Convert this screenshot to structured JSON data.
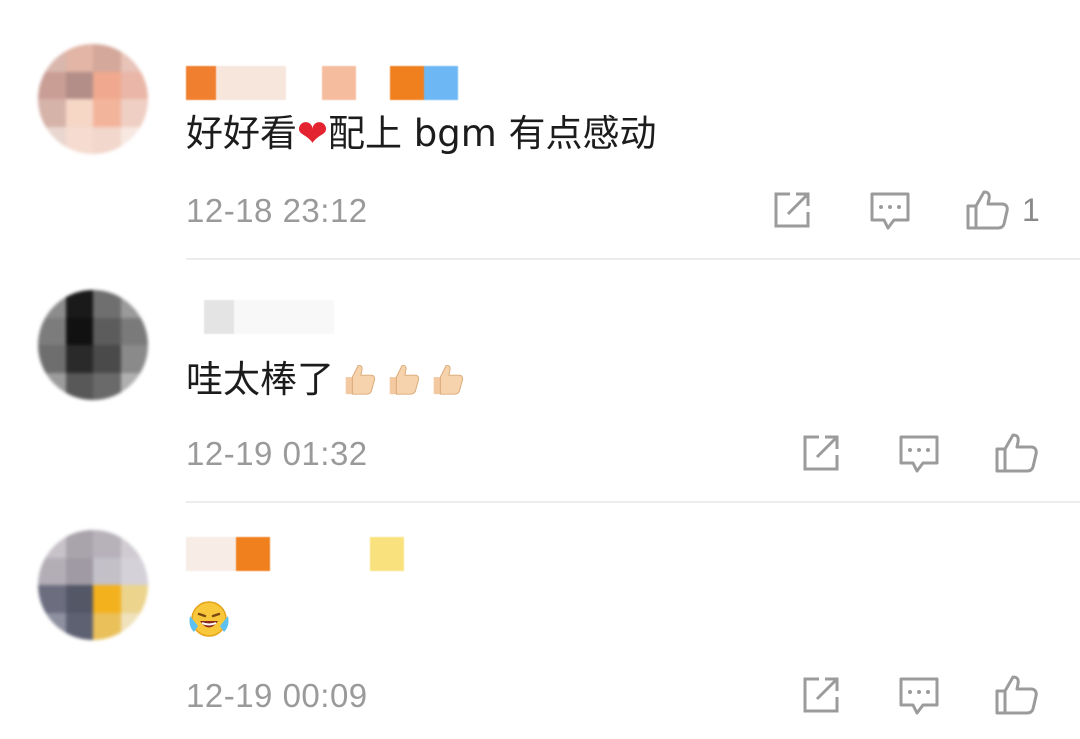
{
  "comments": [
    {
      "text_before": "好好看",
      "heart": "❤",
      "text_after": "配上 bgm 有点感动",
      "time": "12-18 23:12",
      "likes": "1"
    },
    {
      "text_before": "哇太棒了",
      "time": "12-19 01:32",
      "emoji": "thumbs-up x3"
    },
    {
      "emoji": "crying-laughing",
      "time": "12-19 00:09"
    }
  ],
  "icons": {
    "share": "share-icon",
    "reply": "comment-icon",
    "like": "thumbs-up-icon"
  },
  "colors": {
    "timestamp": "#9a9a9a",
    "icon": "#9b9b9b",
    "heart": "#e3232f",
    "divider": "#ececec"
  }
}
